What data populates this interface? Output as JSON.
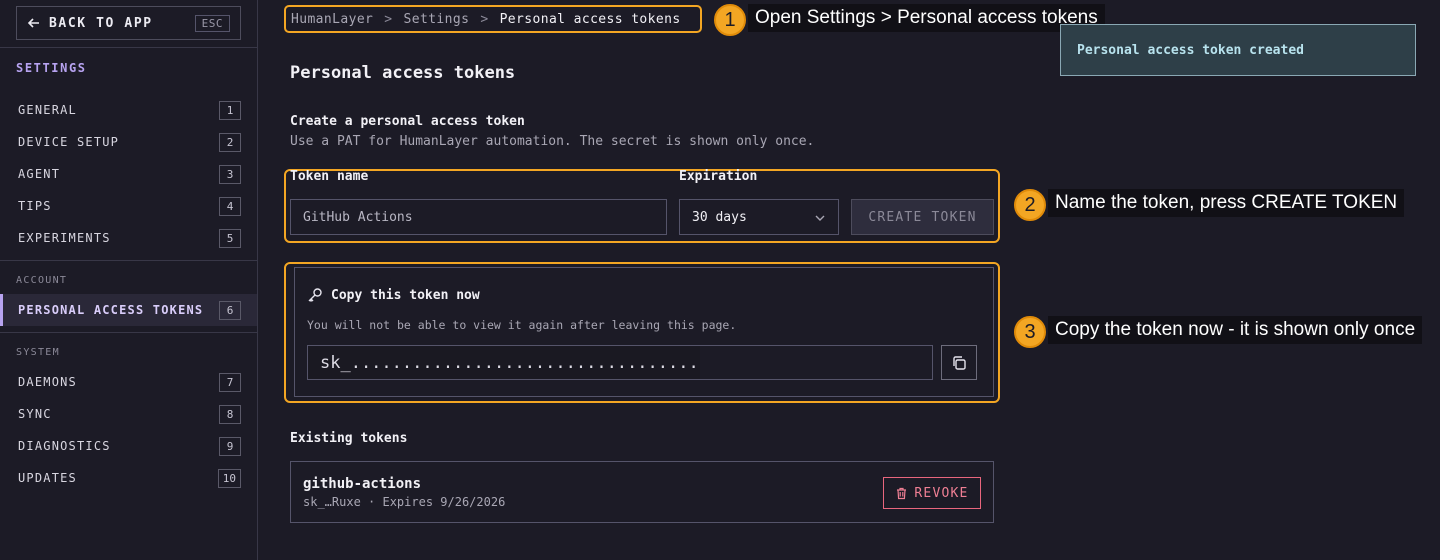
{
  "sidebar": {
    "back_label": "BACK TO APP",
    "back_key": "ESC",
    "section_title": "SETTINGS",
    "account_label": "ACCOUNT",
    "system_label": "SYSTEM",
    "items": [
      {
        "label": "GENERAL",
        "key": "1"
      },
      {
        "label": "DEVICE SETUP",
        "key": "2"
      },
      {
        "label": "AGENT",
        "key": "3"
      },
      {
        "label": "TIPS",
        "key": "4"
      },
      {
        "label": "EXPERIMENTS",
        "key": "5"
      },
      {
        "label": "PERSONAL ACCESS TOKENS",
        "key": "6"
      },
      {
        "label": "DAEMONS",
        "key": "7"
      },
      {
        "label": "SYNC",
        "key": "8"
      },
      {
        "label": "DIAGNOSTICS",
        "key": "9"
      },
      {
        "label": "UPDATES",
        "key": "10"
      }
    ]
  },
  "breadcrumb": {
    "root": "HumanLayer",
    "parent": "Settings",
    "current": "Personal access tokens",
    "separator": ">"
  },
  "callouts": [
    {
      "num": "1",
      "text": "Open Settings > Personal access tokens"
    },
    {
      "num": "2",
      "text": "Name the token, press CREATE TOKEN"
    },
    {
      "num": "3",
      "text": "Copy the token now - it is shown only once"
    }
  ],
  "toast": {
    "text": "Personal access token created"
  },
  "page": {
    "title": "Personal access tokens",
    "create_heading": "Create a personal access token",
    "create_desc": "Use a PAT for HumanLayer automation. The secret is shown only once."
  },
  "form": {
    "name_label": "Token name",
    "name_value": "GitHub Actions",
    "expiration_label": "Expiration",
    "expiration_value": "30 days",
    "create_label": "CREATE TOKEN"
  },
  "new_token": {
    "title": "Copy this token now",
    "warning": "You will not be able to view it again after leaving this page.",
    "secret": "sk_...................................."
  },
  "existing": {
    "heading": "Existing tokens",
    "tokens": [
      {
        "name": "github-actions",
        "meta": "sk_…Ruxe · Expires 9/26/2026",
        "revoke_label": "REVOKE"
      }
    ]
  },
  "colors": {
    "accent": "#b7a3f0",
    "highlight": "#f3a623",
    "danger": "#e8667d",
    "toast_bg": "#2e3f48"
  }
}
